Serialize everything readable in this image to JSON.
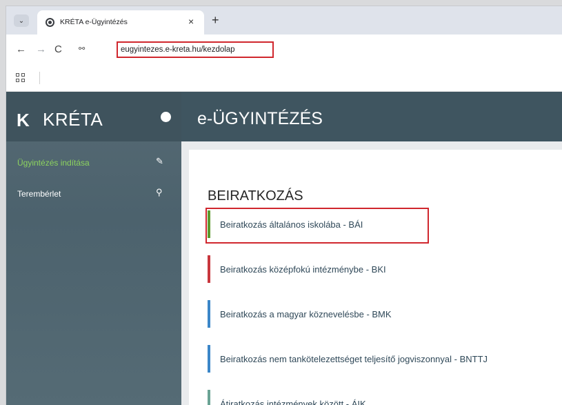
{
  "browser": {
    "tab": {
      "title": "KRÉTA e-Ügyintézés",
      "close": "×",
      "favicon": "chrome-icon"
    },
    "new_tab": "+",
    "tab_menu": "⌄",
    "nav": {
      "back": "←",
      "forward": "→",
      "reload": "C",
      "site_info": "⚯"
    },
    "url": "eugyintezes.e-kreta.hu/kezdolap",
    "highlight_color": "#d0262d"
  },
  "sidebar": {
    "logo_mark": "K",
    "logo_text": "KRÉTA",
    "items": [
      {
        "label": "Ügyintézés indítása",
        "icon": "new-document-icon",
        "glyph": "✎"
      },
      {
        "label": "Terembérlet",
        "icon": "search-icon",
        "glyph": "⚲"
      }
    ],
    "active_color": "#8dd35f"
  },
  "header": {
    "title": "e-ÜGYINTÉZÉS"
  },
  "main": {
    "section_title": "BEIRATKOZÁS",
    "items": [
      {
        "label": "Beiratkozás általános iskolába - BÁI",
        "color": "#5c9a2e"
      },
      {
        "label": "Beiratkozás középfokú intézménybe - BKI",
        "color": "#c8363d"
      },
      {
        "label": "Beiratkozás a magyar köznevelésbe - BMK",
        "color": "#3b86c8"
      },
      {
        "label": "Beiratkozás nem tankötelezettséget teljesítő jogviszonnyal - BNTTJ",
        "color": "#3b86c8"
      },
      {
        "label": "Átiratkozás intézmények között - ÁIK",
        "color": "#6aa394"
      }
    ]
  }
}
